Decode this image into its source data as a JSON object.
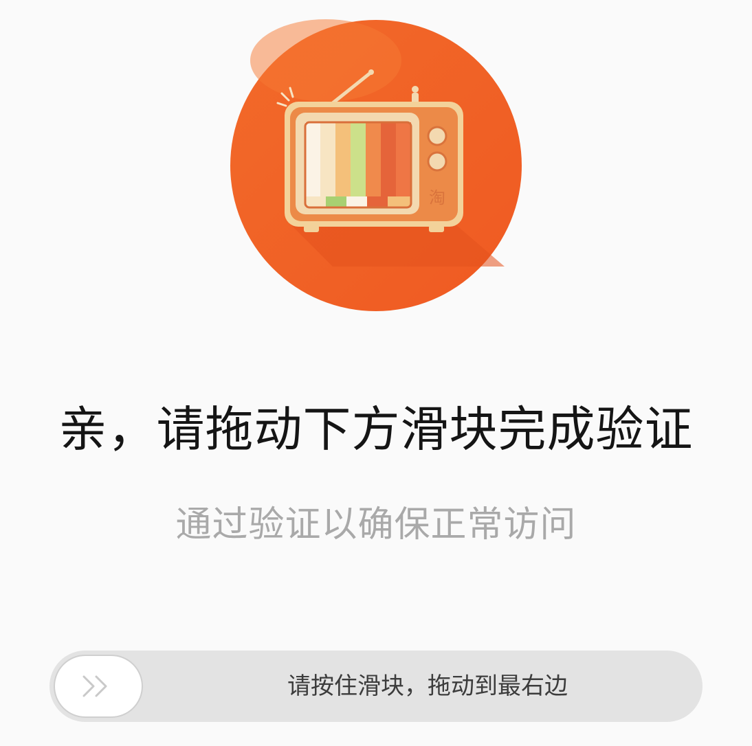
{
  "hero": {
    "icon": "retro-tv-illustration",
    "tv_logo_text": "淘",
    "accent_color": "#f26a2a"
  },
  "headline": "亲，请拖动下方滑块完成验证",
  "subheadline": "通过验证以确保正常访问",
  "slider": {
    "hint": "请按住滑块，拖动到最右边",
    "handle_icon": "double-chevron-right-icon",
    "progress": 0
  }
}
